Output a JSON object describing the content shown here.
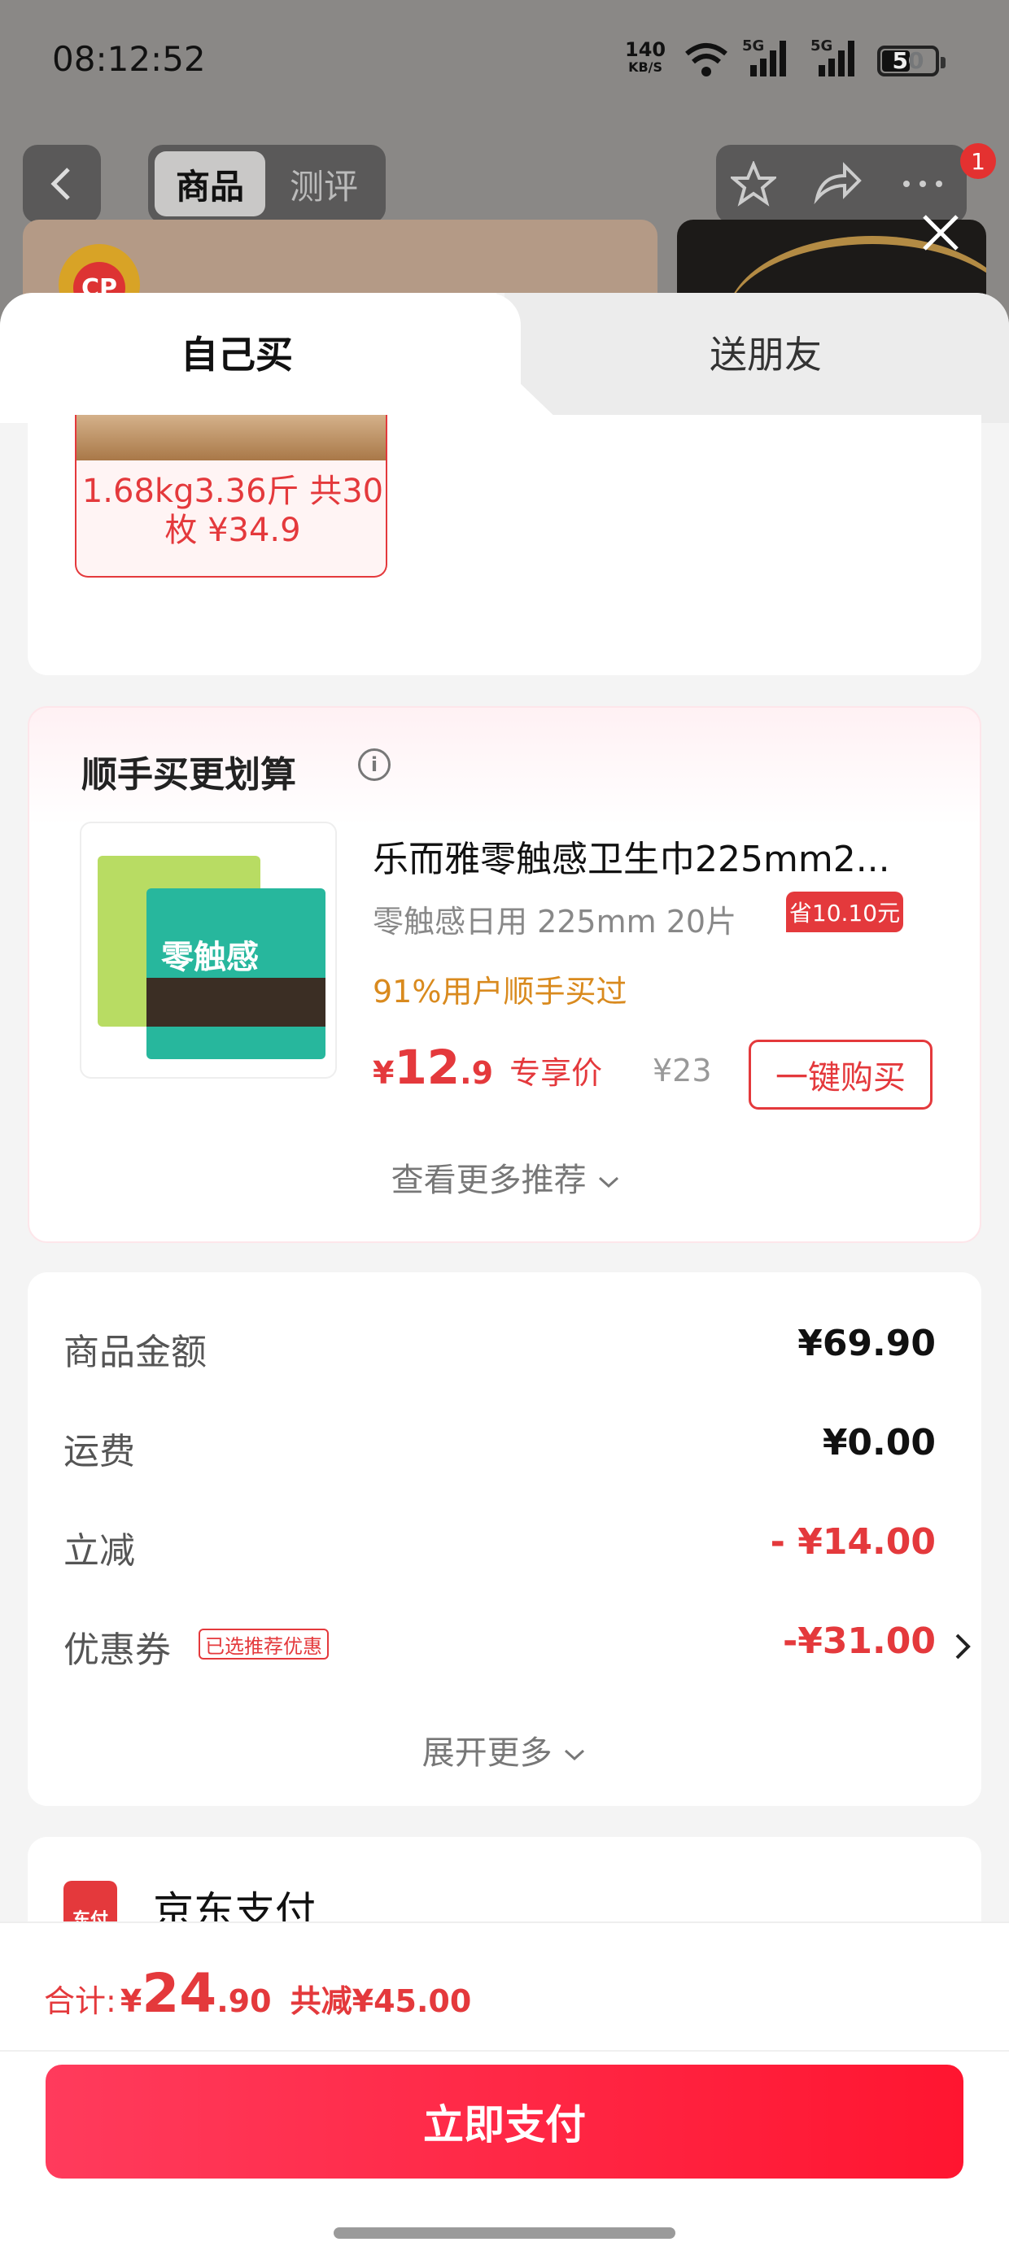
{
  "status_bar": {
    "time": "08:12:52",
    "net_speed": "140",
    "net_unit": "KB/S",
    "sig1": "5G",
    "sig2": "5G",
    "battery": "50"
  },
  "nav": {
    "tab_goods": "商品",
    "tab_review": "测评",
    "cart_badge": "1"
  },
  "hero": {
    "logo_text": "CP"
  },
  "sheet": {
    "tab_self": "自己买",
    "tab_gift": "送朋友"
  },
  "spec": {
    "text": "1.68kg3.36斤 共30枚 ¥34.9"
  },
  "bundle": {
    "title": "顺手买更划算",
    "product_name": "乐而雅零触感卫生巾225mm2...",
    "product_spec": "零触感日用 225mm 20片",
    "bought": "91%用户顺手买过",
    "price_symbol": "¥",
    "price_int": "12",
    "price_dec": ".9",
    "price_label": "专享价",
    "orig_price": "¥23",
    "buy_label": "一键购买",
    "save_tag": "省10.10元",
    "more": "查看更多推荐",
    "pack_text": "零触感"
  },
  "summary": {
    "rows": [
      {
        "label": "商品金额",
        "value": "¥69.90"
      },
      {
        "label": "运费",
        "value": "¥0.00"
      },
      {
        "label": "立减",
        "value": "- ¥14.00"
      },
      {
        "label": "优惠券",
        "value": "-¥31.00",
        "tag": "已选推荐优惠"
      }
    ],
    "expand": "展开更多"
  },
  "payment": {
    "icon_text": "东付",
    "label": "京东支付"
  },
  "bottom": {
    "total_label": "合计:",
    "total_symbol": "¥",
    "total_int": "24",
    "total_dec": ".90",
    "saved": "共减¥45.00",
    "pay_button": "立即支付"
  },
  "colors": {
    "accent": "#e4393c",
    "pay_button": "#ff1530",
    "orange": "#d98a1e"
  }
}
